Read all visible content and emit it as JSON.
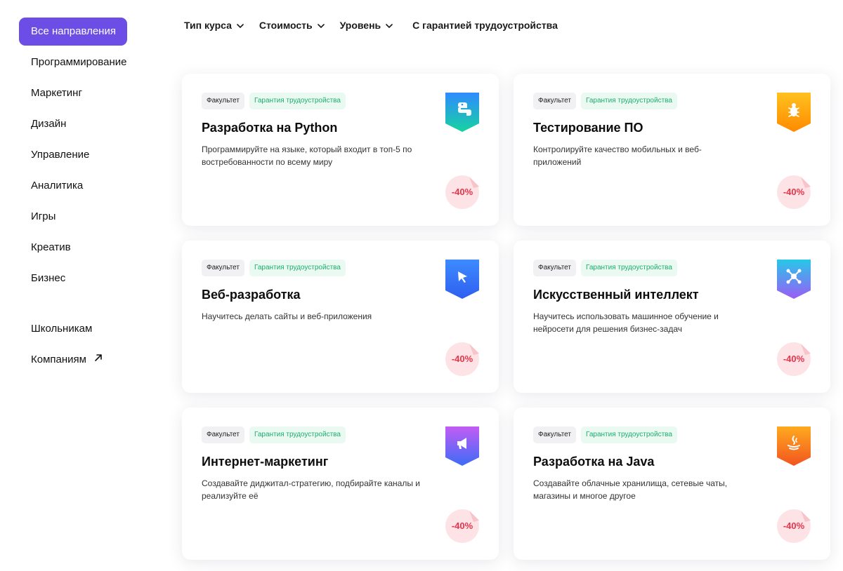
{
  "sidebar": {
    "items": [
      {
        "label": "Все направления",
        "active": true
      },
      {
        "label": "Программирование"
      },
      {
        "label": "Маркетинг"
      },
      {
        "label": "Дизайн"
      },
      {
        "label": "Управление"
      },
      {
        "label": "Аналитика"
      },
      {
        "label": "Игры"
      },
      {
        "label": "Креатив"
      },
      {
        "label": "Бизнес"
      }
    ],
    "extra": [
      {
        "label": "Школьникам"
      },
      {
        "label": "Компаниям",
        "icon": "arrow-up-right-icon"
      }
    ],
    "active_color": "#6c4de6"
  },
  "filters": [
    {
      "label": "Тип курса",
      "icon": "chevron-down-icon"
    },
    {
      "label": "Стоимость",
      "icon": "chevron-down-icon"
    },
    {
      "label": "Уровень",
      "icon": "chevron-down-icon"
    },
    {
      "label": "С гарантией трудоустройства"
    }
  ],
  "cards": [
    {
      "tag1": "Факультет",
      "tag2": "Гарантия трудоустройства",
      "title": "Разработка на Python",
      "desc": "Программируйте на языке, который входит в топ-5 по востребованности по всему миру",
      "discount": "-40%",
      "icon": "python-icon",
      "colors": [
        "#2f8bff",
        "#16d3a0"
      ]
    },
    {
      "tag1": "Факультет",
      "tag2": "Гарантия трудоустройства",
      "title": "Тестирование ПО",
      "desc": "Контролируйте качество мобильных и веб-приложений",
      "discount": "-40%",
      "icon": "bug-icon",
      "colors": [
        "#ffc21f",
        "#ff8a00"
      ]
    },
    {
      "tag1": "Факультет",
      "tag2": "Гарантия трудоустройства",
      "title": "Веб-разработка",
      "desc": "Научитесь делать сайты и веб-приложения",
      "discount": "-40%",
      "icon": "cursor-icon",
      "colors": [
        "#3d8bff",
        "#2f5ff0"
      ]
    },
    {
      "tag1": "Факультет",
      "tag2": "Гарантия трудоустройства",
      "title": "Искусственный интеллект",
      "desc": "Научитесь использовать машинное обучение и нейросети для решения бизнес-задач",
      "discount": "-40%",
      "icon": "network-icon",
      "colors": [
        "#27c8e8",
        "#9b5cf6"
      ]
    },
    {
      "tag1": "Факультет",
      "tag2": "Гарантия трудоустройства",
      "title": "Интернет-маркетинг",
      "desc": "Создавайте диджитал-стратегию, подбирайте каналы и реализуйте её",
      "discount": "-40%",
      "icon": "megaphone-icon",
      "colors": [
        "#c35cf5",
        "#3b6cf6"
      ]
    },
    {
      "tag1": "Факультет",
      "tag2": "Гарантия трудоустройства",
      "title": "Разработка на Java",
      "desc": "Создавайте облачные хранилища, сетевые чаты, магазины и многое другое",
      "discount": "-40%",
      "icon": "java-icon",
      "colors": [
        "#ffaa1f",
        "#f2541f"
      ]
    }
  ]
}
